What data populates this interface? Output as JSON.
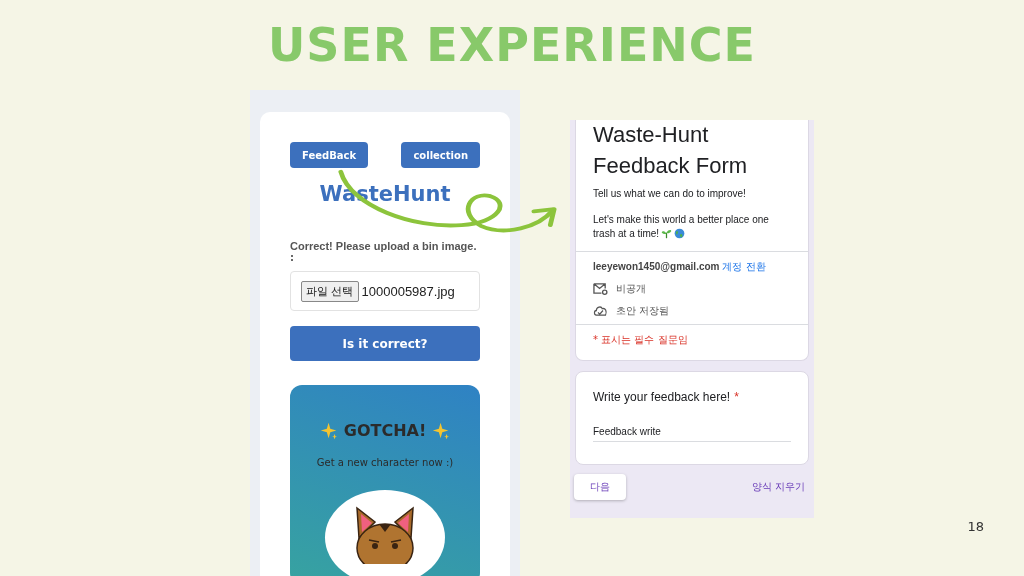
{
  "slide": {
    "title": "USER EXPERIENCE",
    "page_number": "18"
  },
  "app_screen": {
    "buttons": [
      {
        "label": "FeedBack"
      },
      {
        "label": "collection"
      }
    ],
    "logo": "WasteHunt",
    "upload_label": "Correct! Please upload a bin image.",
    "upload_colon": ":",
    "file_button": "파일 선택",
    "file_name": "1000005987.jpg",
    "submit_button": "Is it correct?",
    "gotcha": {
      "title": "GOTCHA!",
      "subtitle": "Get a new character now :)"
    }
  },
  "form_screen": {
    "title": "Waste-Hunt Feedback Form",
    "description": "Tell us what we can do to improve!",
    "description_2": "Let's make this world a better place one",
    "description_3": "trash at a time!",
    "email": "leeyewon1450@gmail.com",
    "switch_account": "계정 전환",
    "privacy": "비공개",
    "draft_status": "초안 저장됨",
    "required_note": "* 표시는 필수 질문임",
    "question": {
      "label": "Write your feedback here!",
      "required_mark": "*",
      "value": "Feedback write"
    },
    "next_button": "다음",
    "clear_link": "양식 지우기"
  }
}
